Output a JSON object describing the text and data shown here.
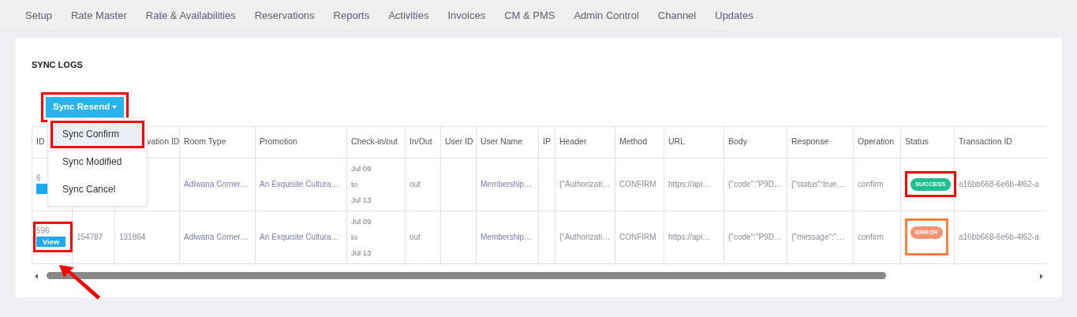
{
  "nav": [
    {
      "label": "Setup"
    },
    {
      "label": "Rate Master"
    },
    {
      "label": "Rate & Availabilities"
    },
    {
      "label": "Reservations"
    },
    {
      "label": "Reports"
    },
    {
      "label": "Activities"
    },
    {
      "label": "Invoices"
    },
    {
      "label": "CM & PMS"
    },
    {
      "label": "Admin Control"
    },
    {
      "label": "Channel"
    },
    {
      "label": "Updates"
    }
  ],
  "section_title": "SYNC LOGS",
  "dropdown": {
    "label": "Sync Resend",
    "highlighted": true,
    "items": [
      {
        "label": "Sync Confirm",
        "selected": true,
        "highlighted": true
      },
      {
        "label": "Sync Modified",
        "selected": false,
        "highlighted": false
      },
      {
        "label": "Sync Cancel",
        "selected": false,
        "highlighted": false
      }
    ]
  },
  "table": {
    "columns": [
      "ID",
      "",
      "vation ID",
      "Room Type",
      "Promotion",
      "Check-in/out",
      "In/Out",
      "User ID",
      "User Name",
      "IP",
      "Header",
      "Method",
      "URL",
      "Body",
      "Response",
      "Operation",
      "Status",
      "Transaction ID"
    ],
    "rows": [
      {
        "cells": [
          {
            "kind": "id",
            "text": "6",
            "highlighted": false
          },
          "",
          "",
          "Adiwana Corner…",
          "An Exquisite Cultura…",
          [
            "Jul 09",
            "to",
            "Jul 13"
          ],
          "out",
          "",
          "Membership…",
          "",
          "{\"Authorizati…",
          "CONFIRM",
          "https://api…",
          "{\"code\":\"P9D…",
          "{\"status\":true,…",
          "confirm",
          {
            "kind": "status",
            "label": "SUCCESS",
            "color": "#1ec08f",
            "highlighted": true
          },
          "a16bb668-6e6b-4f62-a"
        ]
      },
      {
        "cells": [
          {
            "kind": "id",
            "text": "596",
            "view": "View",
            "highlighted": true
          },
          "154787",
          "131864",
          "Adiwana Corner…",
          "An Exquisite Cultura…",
          [
            "Jul 09",
            "to",
            "Jul 13"
          ],
          "out",
          "",
          "Membership…",
          "",
          "{\"Authorizati…",
          "CONFIRM",
          "https://api…",
          "{\"code\":\"P9D…",
          "{\"message\":\"…",
          "confirm",
          {
            "kind": "status",
            "label": "ERROR",
            "color": "#fa9274",
            "highlighted": true
          },
          "a16bb668-6e6b-4f62-a"
        ]
      }
    ]
  }
}
